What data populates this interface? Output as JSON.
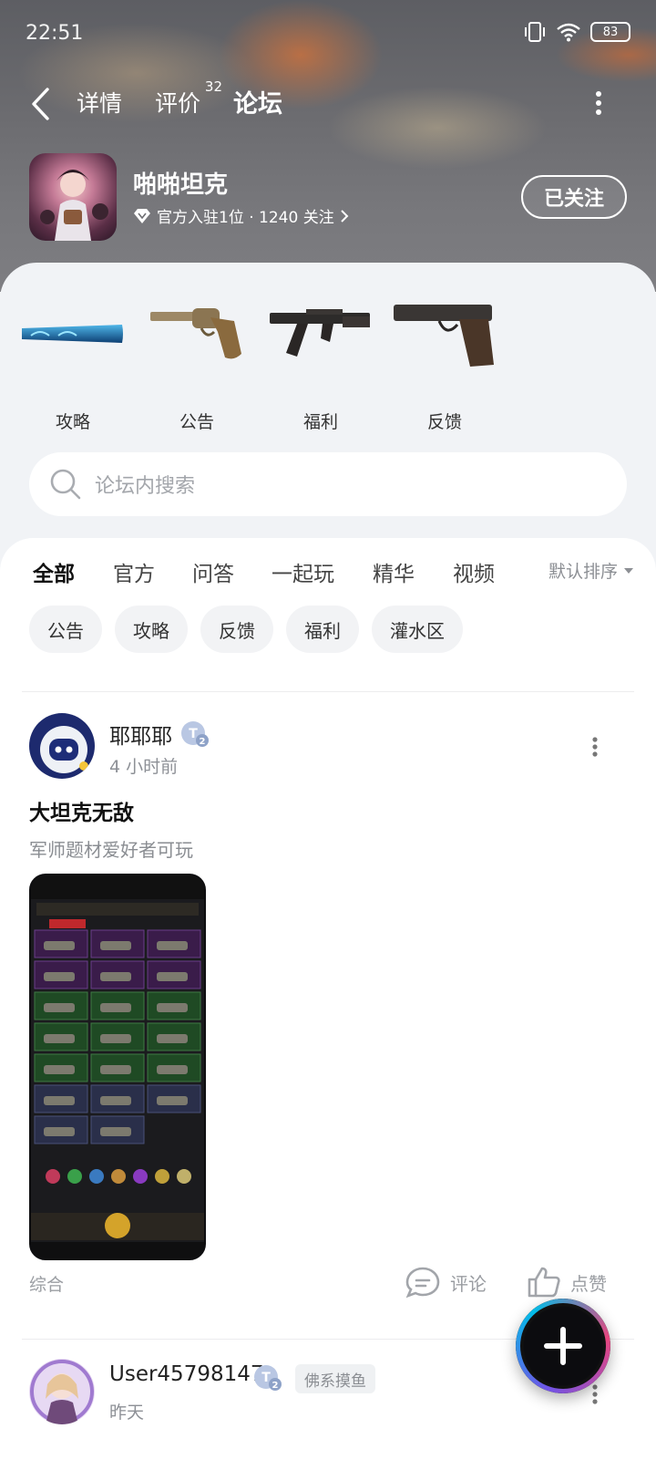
{
  "status": {
    "time": "22:51",
    "battery": "83"
  },
  "nav": {
    "tabs": [
      {
        "label": "详情"
      },
      {
        "label": "评价",
        "count": "32"
      },
      {
        "label": "论坛"
      }
    ],
    "active": "论坛"
  },
  "game": {
    "name": "啪啪坦克",
    "meta": "官方入驻1位 · 1240 关注",
    "follow_label": "已关注"
  },
  "categories": [
    {
      "label": "攻略",
      "icon": "bat-icon"
    },
    {
      "label": "公告",
      "icon": "revolver-icon"
    },
    {
      "label": "福利",
      "icon": "rifle-icon"
    },
    {
      "label": "反馈",
      "icon": "pistol-icon"
    }
  ],
  "search": {
    "placeholder": "论坛内搜索"
  },
  "feed_tabs": [
    "全部",
    "官方",
    "问答",
    "一起玩",
    "精华",
    "视频"
  ],
  "feed_active": "全部",
  "sort_label": "默认排序",
  "chips": [
    "公告",
    "攻略",
    "反馈",
    "福利",
    "灌水区"
  ],
  "posts": [
    {
      "user": "耶耶耶",
      "time": "4 小时前",
      "title": "大坦克无敌",
      "body": "军师题材爱好者可玩",
      "tag": "综合",
      "comment_label": "评论",
      "like_label": "点赞"
    },
    {
      "user": "User45798147",
      "user_tag": "佛系摸鱼",
      "time": "昨天"
    }
  ],
  "colors": {
    "accent": "#1fd1b0"
  }
}
